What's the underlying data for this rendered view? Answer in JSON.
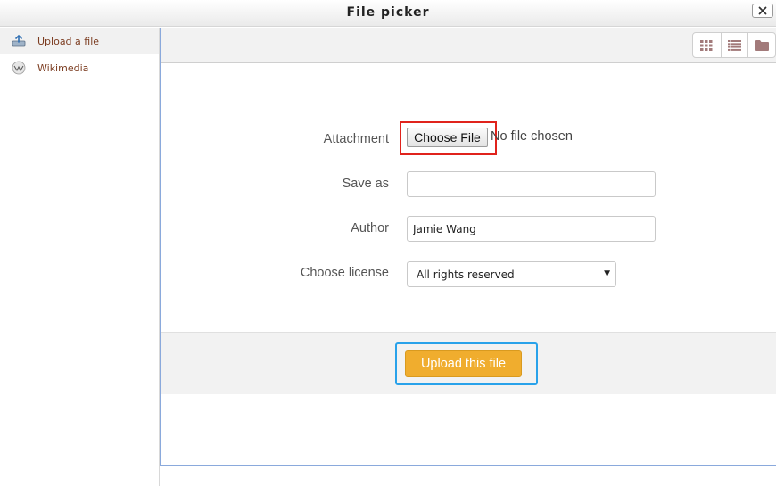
{
  "window": {
    "title": "File picker",
    "close_label": "×"
  },
  "sidebar": {
    "items": [
      {
        "label": "Upload a file",
        "icon": "upload-icon",
        "active": true
      },
      {
        "label": "Wikimedia",
        "icon": "wikipedia-icon",
        "active": false
      }
    ]
  },
  "toolbar": {
    "views": [
      "icons-view-icon",
      "list-view-icon",
      "folder-view-icon"
    ]
  },
  "form": {
    "attachment": {
      "label": "Attachment",
      "button": "Choose File",
      "status": "No file chosen"
    },
    "save_as": {
      "label": "Save as",
      "value": ""
    },
    "author": {
      "label": "Author",
      "value": "Jamie Wang"
    },
    "license": {
      "label": "Choose license",
      "value": "All rights reserved"
    }
  },
  "footer": {
    "upload_button": "Upload this file"
  },
  "colors": {
    "accent": "#f0ad2e",
    "highlight_red": "#e0231c",
    "highlight_blue": "#29a2ea",
    "link": "#7b3b1f"
  }
}
